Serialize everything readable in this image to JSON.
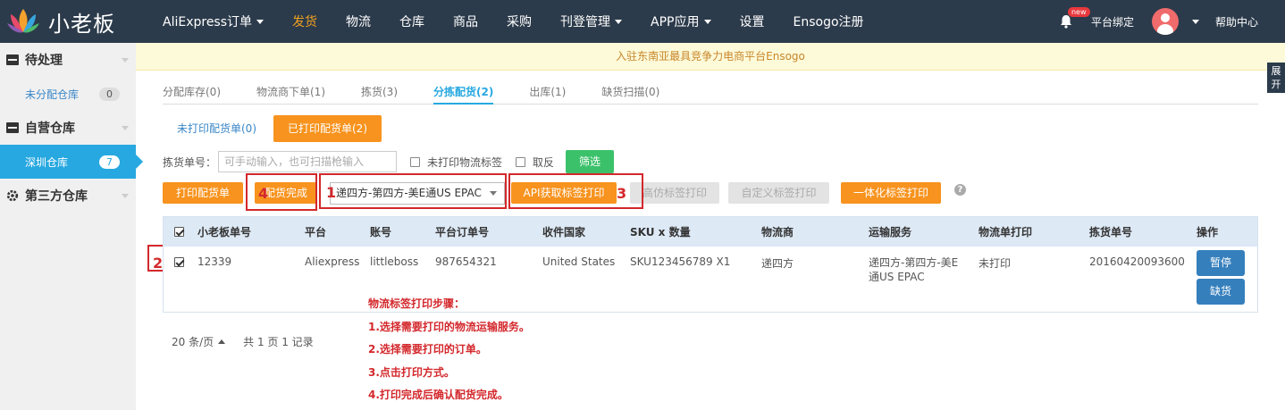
{
  "app": {
    "logo_text": "小老板",
    "nav": [
      {
        "label": "AliExpress订单",
        "dropdown": true,
        "active": false
      },
      {
        "label": "发货",
        "dropdown": false,
        "active": true
      },
      {
        "label": "物流",
        "dropdown": false,
        "active": false
      },
      {
        "label": "仓库",
        "dropdown": false,
        "active": false
      },
      {
        "label": "商品",
        "dropdown": false,
        "active": false
      },
      {
        "label": "采购",
        "dropdown": false,
        "active": false
      },
      {
        "label": "刊登管理",
        "dropdown": true,
        "active": false
      },
      {
        "label": "APP应用",
        "dropdown": true,
        "active": false
      },
      {
        "label": "设置",
        "dropdown": false,
        "active": false
      },
      {
        "label": "Ensogo注册",
        "dropdown": false,
        "active": false
      }
    ],
    "new_badge": "new",
    "bind_label": "平台绑定",
    "help_label": "帮助中心",
    "accent_color": "#f7931e",
    "nav_bg": "#2c3b4b"
  },
  "sidebar": {
    "groups": [
      {
        "label": "待处理",
        "icon": "inbox-icon",
        "items": [
          {
            "label": "未分配仓库",
            "count": "0",
            "active": false
          }
        ]
      },
      {
        "label": "自营仓库",
        "icon": "warehouse-icon",
        "items": [
          {
            "label": "深圳仓库",
            "count": "7",
            "active": true
          }
        ]
      },
      {
        "label": "第三方仓库",
        "icon": "gear-icon",
        "items": []
      }
    ]
  },
  "banner": {
    "text": "入驻东南亚最具竞争力电商平台Ensogo"
  },
  "expand": {
    "label": "展开"
  },
  "tabs": [
    {
      "label": "分配库存(0)",
      "active": false
    },
    {
      "label": "物流商下单(1)",
      "active": false
    },
    {
      "label": "拣货(3)",
      "active": false
    },
    {
      "label": "分拣配货(2)",
      "active": true
    },
    {
      "label": "出库(1)",
      "active": false
    },
    {
      "label": "缺货扫描(0)",
      "active": false
    }
  ],
  "subtabs": [
    {
      "label": "未打印配货单(0)",
      "active": false
    },
    {
      "label": "已打印配货单(2)",
      "active": true
    }
  ],
  "filter": {
    "label": "拣货单号：",
    "placeholder": "可手动输入，也可扫描枪输入",
    "check_unprinted": "未打印物流标签",
    "check_invert": "取反",
    "submit": "筛选"
  },
  "actions": {
    "print_picklist": "打印配货单",
    "confirm_picking": "配货完成",
    "shipping_service": "递四方-第四方-美E通US EPAC",
    "api_print": "API获取标签打印",
    "imitation_print": "高仿标签打印",
    "custom_print": "自定义标签打印",
    "integrated_print": "一体化标签打印",
    "help": "?"
  },
  "annotations": {
    "n1": "1",
    "n2": "2",
    "n3": "3",
    "n4": "4"
  },
  "table": {
    "columns": [
      "小老板单号",
      "平台",
      "账号",
      "平台订单号",
      "收件国家",
      "SKU x 数量",
      "物流商",
      "运输服务",
      "物流单打印",
      "拣货单号",
      "操作"
    ],
    "rows": [
      {
        "id": "12339",
        "platform": "Aliexpress",
        "account": "littleboss",
        "order_no": "987654321",
        "country": "United States",
        "sku": "SKU123456789 X1",
        "carrier": "递四方",
        "service": "递四方-第四方-美E通US EPAC",
        "label_print": "未打印",
        "pick_no": "20160420093600",
        "btn_pause": "暂停",
        "btn_outstock": "缺货"
      }
    ]
  },
  "steps": {
    "title": "物流标签打印步骤：",
    "items": [
      "1.选择需要打印的物流运输服务。",
      "2.选择需要打印的订单。",
      "3.点击打印方式。",
      "4.打印完成后确认配货完成。"
    ]
  },
  "pager": {
    "per_page": "20 条/页",
    "summary": "共 1 页 1 记录"
  }
}
